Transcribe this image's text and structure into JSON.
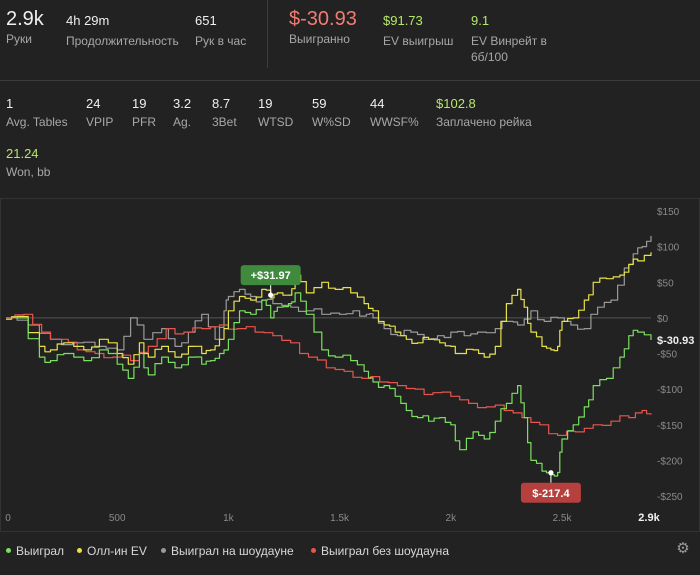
{
  "summary": {
    "hands": {
      "value": "2.9k",
      "label": "Руки"
    },
    "duration": {
      "value": "4h 29m",
      "label": "Продолжительность"
    },
    "hands_per_hour": {
      "value": "651",
      "label": "Рук в час"
    },
    "won": {
      "value": "$-30.93",
      "label": "Выигранно"
    },
    "ev_won": {
      "value": "$91.73",
      "label": "EV выигрыш"
    },
    "ev_winrate": {
      "value": "9.1",
      "label": "EV Винрейт в 6б/100"
    }
  },
  "stats": {
    "avg_tables": {
      "value": "1",
      "label": "Avg. Tables"
    },
    "vpip": {
      "value": "24",
      "label": "VPIP"
    },
    "pfr": {
      "value": "19",
      "label": "PFR"
    },
    "ag": {
      "value": "3.2",
      "label": "Ag."
    },
    "threebet": {
      "value": "8.7",
      "label": "3Bet"
    },
    "wtsd": {
      "value": "19",
      "label": "WTSD"
    },
    "wsd": {
      "value": "59",
      "label": "W%SD"
    },
    "wwsf": {
      "value": "44",
      "label": "WWSF%"
    },
    "rake": {
      "value": "$102.8",
      "label": "Заплачено рейка"
    },
    "won_bb": {
      "value": "21.24",
      "label": "Won, bb"
    }
  },
  "colors": {
    "won": "#7be05f",
    "allin_ev": "#e8e24a",
    "showdown": "#9a9a9a",
    "non_showdown": "#e8554e",
    "badge_green": "#3f8a3c",
    "badge_red": "#b5403d"
  },
  "chart_data": {
    "type": "line",
    "x_ticks": [
      "0",
      "500",
      "1k",
      "1.5k",
      "2k",
      "2.5k",
      "2.9k"
    ],
    "x_tick_values": [
      0,
      500,
      1000,
      1500,
      2000,
      2500,
      2900
    ],
    "y_ticks": [
      "$150",
      "$100",
      "$50",
      "$0",
      "-$50",
      "-$100",
      "-$150",
      "-$200",
      "-$250"
    ],
    "y_tick_values": [
      150,
      100,
      50,
      0,
      -50,
      -100,
      -150,
      -200,
      -250
    ],
    "xlim": [
      0,
      2900
    ],
    "ylim": [
      -250,
      150
    ],
    "series": [
      {
        "name": "Выиграл",
        "color": "#7be05f",
        "x": [
          0,
          50,
          150,
          200,
          260,
          350,
          420,
          500,
          550,
          600,
          640,
          700,
          760,
          820,
          880,
          920,
          960,
          1000,
          1050,
          1100,
          1150,
          1190,
          1220,
          1270,
          1300,
          1350,
          1420,
          1480,
          1550,
          1610,
          1650,
          1700,
          1750,
          1800,
          1850,
          1900,
          1950,
          2000,
          2040,
          2100,
          2150,
          2200,
          2250,
          2300,
          2330,
          2360,
          2410,
          2450,
          2480,
          2500,
          2550,
          2600,
          2640,
          2700,
          2760,
          2800,
          2840,
          2900
        ],
        "y": [
          -2,
          0,
          -55,
          -60,
          -50,
          -60,
          -45,
          -65,
          -85,
          -50,
          -80,
          -55,
          -70,
          -55,
          -65,
          -60,
          -50,
          -30,
          10,
          5,
          25,
          0,
          15,
          20,
          35,
          5,
          -45,
          -55,
          -60,
          -75,
          -90,
          -95,
          -110,
          -130,
          -140,
          -145,
          -140,
          -150,
          -185,
          -160,
          -170,
          -145,
          -120,
          -95,
          -140,
          -200,
          -215,
          -220,
          -217,
          -170,
          -150,
          -125,
          -95,
          -85,
          -55,
          -25,
          -20,
          -31
        ]
      },
      {
        "name": "Олл-ин EV",
        "color": "#e8e24a",
        "x": [
          0,
          50,
          150,
          200,
          260,
          350,
          420,
          500,
          550,
          600,
          640,
          700,
          760,
          820,
          880,
          920,
          960,
          1000,
          1050,
          1100,
          1150,
          1190,
          1220,
          1270,
          1300,
          1350,
          1420,
          1480,
          1550,
          1610,
          1650,
          1700,
          1750,
          1800,
          1850,
          1900,
          1950,
          2000,
          2040,
          2100,
          2150,
          2200,
          2250,
          2300,
          2330,
          2360,
          2410,
          2450,
          2480,
          2500,
          2550,
          2600,
          2640,
          2700,
          2760,
          2800,
          2840,
          2900
        ],
        "y": [
          -2,
          2,
          -40,
          -45,
          -35,
          -45,
          -30,
          -50,
          -65,
          -35,
          -55,
          -40,
          -55,
          -40,
          -50,
          -45,
          -30,
          10,
          30,
          25,
          40,
          28,
          35,
          32,
          60,
          35,
          50,
          40,
          35,
          20,
          10,
          -10,
          -20,
          -30,
          -35,
          -30,
          -35,
          -40,
          -50,
          -45,
          -55,
          -40,
          20,
          40,
          15,
          -20,
          -40,
          -45,
          -40,
          -5,
          0,
          25,
          50,
          55,
          60,
          75,
          80,
          92
        ]
      },
      {
        "name": "Выиграл на шоудауне",
        "color": "#9a9a9a",
        "x": [
          0,
          100,
          200,
          300,
          400,
          500,
          560,
          620,
          700,
          760,
          820,
          880,
          940,
          980,
          1000,
          1050,
          1100,
          1150,
          1200,
          1280,
          1350,
          1420,
          1500,
          1560,
          1620,
          1650,
          1700,
          1760,
          1820,
          1880,
          1940,
          2000,
          2060,
          2120,
          2200,
          2260,
          2300,
          2360,
          2420,
          2480,
          2540,
          2600,
          2660,
          2720,
          2780,
          2820,
          2860,
          2900
        ],
        "y": [
          0,
          -10,
          -30,
          -35,
          -40,
          -45,
          0,
          -30,
          -15,
          -40,
          -20,
          5,
          -30,
          10,
          30,
          40,
          30,
          25,
          20,
          15,
          10,
          5,
          5,
          10,
          5,
          0,
          -15,
          -25,
          -20,
          -30,
          -25,
          -20,
          -25,
          -20,
          -15,
          -5,
          -10,
          10,
          -5,
          0,
          -10,
          -15,
          15,
          25,
          70,
          90,
          100,
          115
        ]
      },
      {
        "name": "Выиграл без шоудауна",
        "color": "#e8554e",
        "x": [
          0,
          80,
          160,
          240,
          320,
          400,
          480,
          560,
          640,
          720,
          800,
          880,
          960,
          1040,
          1120,
          1200,
          1280,
          1360,
          1440,
          1520,
          1600,
          1680,
          1760,
          1840,
          1920,
          2000,
          2080,
          2160,
          2240,
          2320,
          2400,
          2480,
          2560,
          2640,
          2720,
          2800,
          2860,
          2900
        ],
        "y": [
          0,
          5,
          -20,
          -30,
          -45,
          -50,
          -55,
          -60,
          -40,
          -15,
          -20,
          -15,
          -10,
          -15,
          -20,
          -25,
          -35,
          -55,
          -70,
          -75,
          -85,
          -90,
          -95,
          -100,
          -105,
          -110,
          -120,
          -125,
          -130,
          -140,
          -150,
          -165,
          -160,
          -150,
          -145,
          -140,
          -130,
          -136
        ]
      }
    ],
    "annotations": [
      {
        "text": "+$31.97",
        "x": 1190,
        "y": 32,
        "series": "Выиграл на шоудауне",
        "color": "#3f8a3c"
      },
      {
        "text": "$-217.4",
        "x": 2450,
        "y": -217.4,
        "series": "Выиграл",
        "color": "#b5403d"
      }
    ],
    "end_label": "$-30.93",
    "grid": false
  },
  "legend": [
    {
      "label": "Выиграл",
      "color": "#7be05f"
    },
    {
      "label": "Олл-ин EV",
      "color": "#e8e24a"
    },
    {
      "label": "Выиграл на шоудауне",
      "color": "#9a9a9a"
    },
    {
      "label": "Выиграл без шоудауна",
      "color": "#e8554e"
    }
  ]
}
